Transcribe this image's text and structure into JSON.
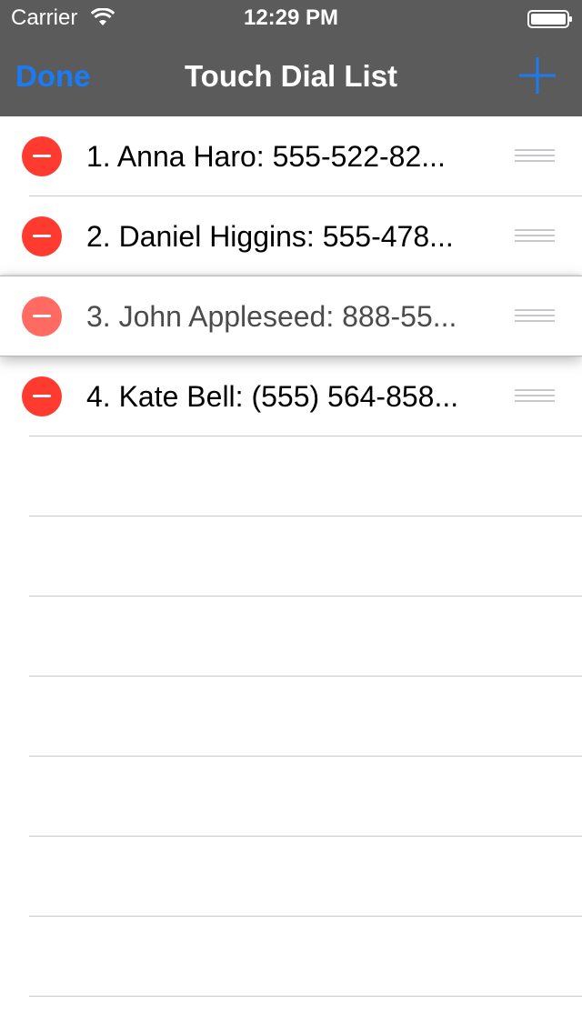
{
  "status_bar": {
    "carrier": "Carrier",
    "time": "12:29 PM",
    "icons": [
      "wifi-icon",
      "battery-icon"
    ]
  },
  "nav_bar": {
    "done_label": "Done",
    "title": "Touch Dial List",
    "add_icon": "plus-icon"
  },
  "colors": {
    "nav_background": "#5b5b5b",
    "tint": "#1a7cf4",
    "delete_red": "#ff3b30"
  },
  "contacts": [
    {
      "label": "1. Anna Haro: 555-522-82...",
      "state": "normal"
    },
    {
      "label": "2. Daniel Higgins: 555-478...",
      "state": "normal"
    },
    {
      "label": "3. John Appleseed: 888-55...",
      "state": "dragging"
    },
    {
      "label": "4. Kate Bell: (555) 564-858...",
      "state": "normal"
    }
  ]
}
